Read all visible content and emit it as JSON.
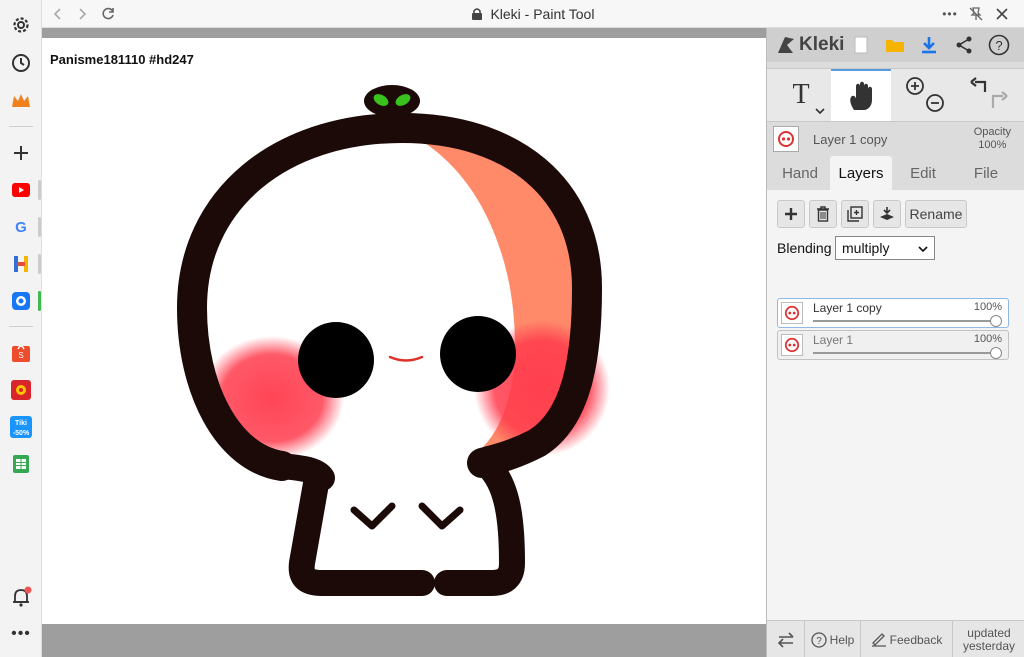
{
  "browser": {
    "title": "Kleki - Paint Tool",
    "sidebar_icons": [
      "gear-icon",
      "history-icon",
      "crown-icon",
      "add-icon",
      "youtube-icon",
      "google-icon",
      "h-app-icon",
      "messenger-icon",
      "shopee-icon",
      "game-icon",
      "tiki-icon",
      "sheets-icon",
      "bell-icon",
      "more-icon"
    ],
    "tiki_badge": "-50%"
  },
  "canvas": {
    "label": "Panisme181110 #hd247"
  },
  "panel": {
    "logo": "Kleki",
    "layer_name": "Layer 1 copy",
    "opacity_label": "Opacity",
    "opacity_value": "100%",
    "tabs": [
      "Hand",
      "Layers",
      "Edit",
      "File"
    ],
    "active_tab": "Layers",
    "rename_label": "Rename",
    "blending_label": "Blending",
    "blending_value": "multiply",
    "layers": [
      {
        "name": "Layer 1 copy",
        "opacity": "100%",
        "opacity_fraction": 1.0,
        "selected": true
      },
      {
        "name": "Layer 1",
        "opacity": "100%",
        "opacity_fraction": 1.0,
        "selected": false
      }
    ],
    "footer": {
      "help": "Help",
      "feedback": "Feedback",
      "updated_line1": "updated",
      "updated_line2": "yesterday"
    }
  },
  "colors": {
    "accent": "#5a9be0",
    "stroke": "#1b0a08",
    "blush": "#ff3b4d",
    "hair": "#ff8a6a",
    "sprout": "#39c21d"
  }
}
